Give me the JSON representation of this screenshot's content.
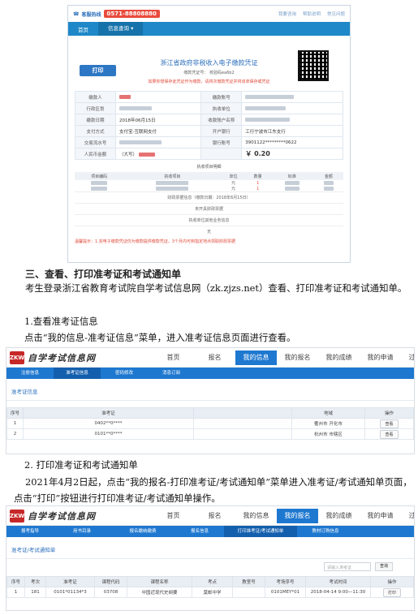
{
  "payment": {
    "hotline_label": "客服热线",
    "hotline_number": "0571-88808880",
    "top_links": [
      "我要咨询",
      "帮助说明",
      "常见问题"
    ],
    "nav": [
      "首页",
      "信息查询 ▾"
    ],
    "print_label": "打印",
    "title": "浙江省政府非税收入电子缴款凭证",
    "sub": "缴款凭证号：              校验码ea6b2",
    "note": "如果你想保存此凭证作为缴款，请将次缴款凭证并将该单保存或凭证",
    "rows": [
      [
        "缴款人",
        "",
        "缴款账号",
        ""
      ],
      [
        "行政区划",
        "",
        "执收单位",
        ""
      ],
      [
        "缴款日期",
        "2018年06月15日",
        "收款账户名称",
        ""
      ],
      [
        "支付方式",
        "支付宝-互联网支付",
        "开户银行",
        "工行宁波市江东支行"
      ],
      [
        "交易流水号",
        "",
        "银行账号",
        "3901122*********0622"
      ],
      [
        "人民币金额",
        "（大写）",
        "",
        "￥ 0.20"
      ]
    ],
    "items_title": "执收项目明细",
    "items_headers": [
      "项目编码",
      "执收项目",
      "单位",
      "数量",
      "标准",
      "金额"
    ],
    "items_rows": [
      [
        "",
        "",
        "元",
        "1",
        "",
        ""
      ],
      [
        "",
        "",
        "元",
        "1",
        "",
        ""
      ]
    ],
    "footer_lines": [
      "财政票据信息（缴款日期：2018年6月15日）",
      "未开具财政票据",
      "执收单位其他业务信息",
      "无"
    ],
    "warning": "温馨提示：1.完电子缴款凭证仅为缴款提供缴款凭证，3个月内可到指定地点领取财政票据"
  },
  "doc": {
    "h3": "三、查看、打印准考证和考试通知单",
    "p1": "考生登录浙江省教育考试院自学考试信息网（zk.zjzs.net）查看、打印准考证和考试通知单。",
    "p2": "1.查看准考证信息",
    "p3": "点击“我的信息-准考证信息”菜单，进入准考证信息页面进行查看。",
    "p4": "2. 打印准考证和考试通知单",
    "p5": "2021年4月2日起，点击“我的报名-打印准考证/考试通知单”菜单进入准考证/考试通知单页面，点击“打印”按钮进行打印准考证/考试通知单操作。"
  },
  "site1": {
    "logo_mark": "ZKW",
    "logo": "自学考试信息网",
    "nav": [
      "首页",
      "报名",
      "我的信息",
      "我的报名",
      "我的成绩",
      "我的申请",
      "过程考试"
    ],
    "subnav": [
      "注册信息",
      "准考证信息",
      "密码修改",
      "消息订阅"
    ],
    "section": "准考证信息",
    "headers": [
      "序号",
      "准考证",
      "",
      "地域",
      "操作"
    ],
    "rows": [
      [
        "1",
        "0402**0****",
        "",
        "衢州市 开化市",
        "查看"
      ],
      [
        "2",
        "0101**0****",
        "",
        "杭州市 市辖区",
        "查看"
      ]
    ]
  },
  "site2": {
    "logo_mark": "ZKW",
    "logo": "自学考试信息网",
    "nav": [
      "首页",
      "报名",
      "我的信息",
      "我的报名",
      "我的成绩",
      "我的申请",
      "过程考试"
    ],
    "subnav": [
      "报考指导",
      "用书目录",
      "报名缴纳缴费",
      "报名信息",
      "打印准考证/考试通知单",
      "教材订购信息"
    ],
    "section": "准考证/考试通知单",
    "search_placeholder": "请输入准考证",
    "search_btn": "查询",
    "headers": [
      "序号",
      "考次",
      "准考证",
      "课程代码",
      "课程名称",
      "考点",
      "教室号",
      "考场序号",
      "考试时间",
      "操作"
    ],
    "rows": [
      [
        "1",
        "181",
        "0101*01134*3",
        "03708",
        "中国近现代史纲要",
        "莫邮中学",
        "",
        "0101MEY*01",
        "2018-04-14 9:00—11:30",
        "打印"
      ]
    ]
  }
}
